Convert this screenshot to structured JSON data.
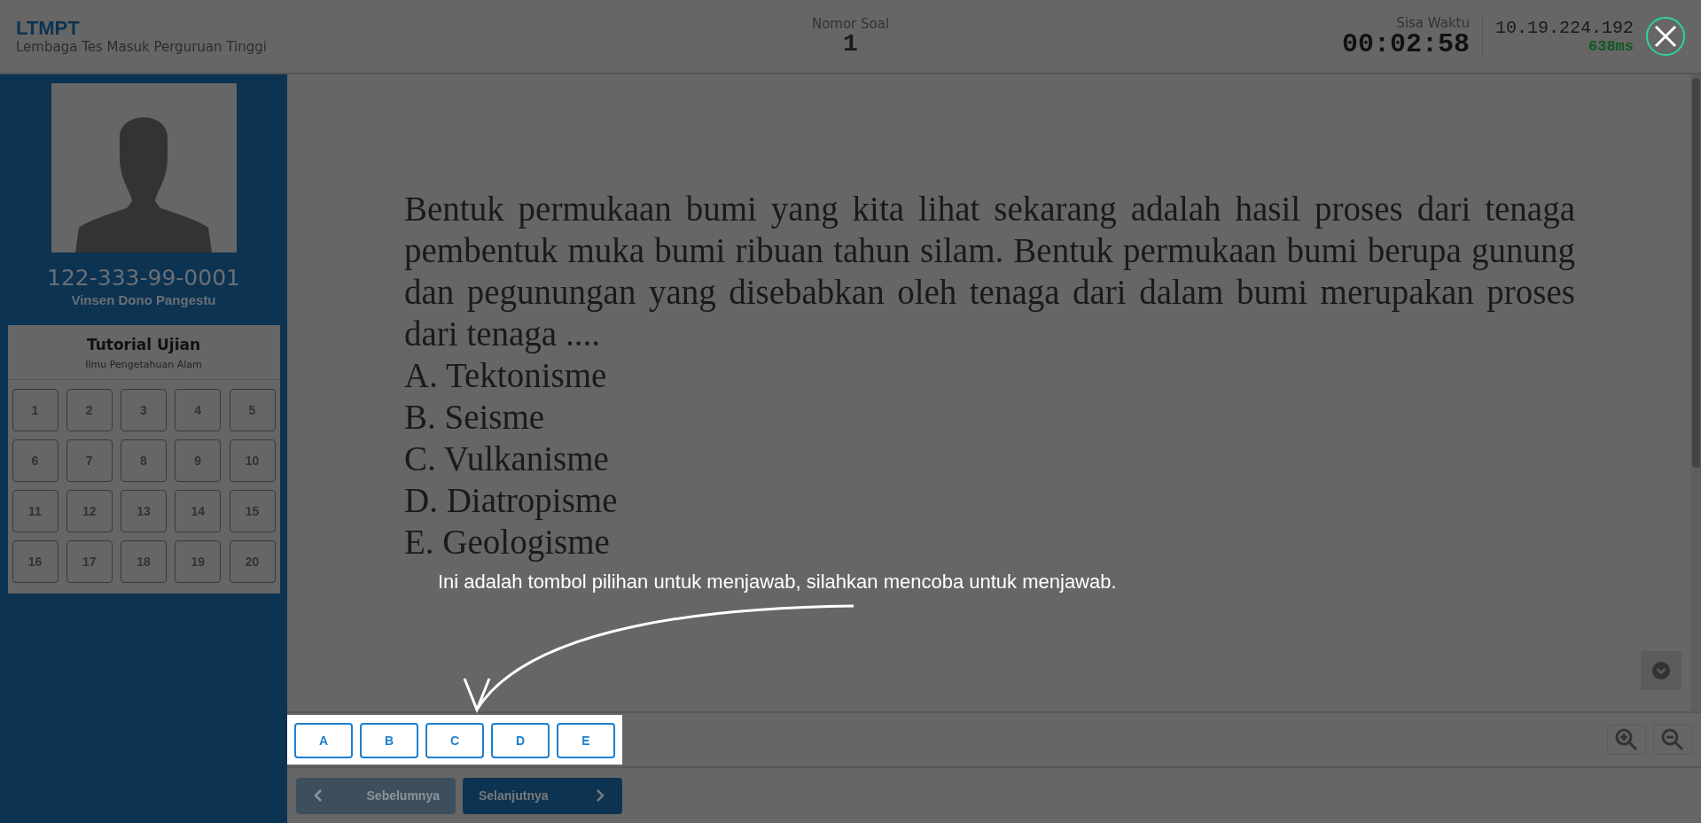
{
  "header": {
    "logo": "LTMPT",
    "subtitle": "Lembaga Tes Masuk Perguruan Tinggi",
    "question_label": "Nomor Soal",
    "question_number": "1",
    "timer_label": "Sisa Waktu",
    "timer": "00:02:58",
    "ip": "10.19.224.192",
    "latency": "638ms"
  },
  "participant": {
    "id": "122-333-99-0001",
    "name": "Vinsen Dono Pangestu"
  },
  "exam": {
    "title": "Tutorial Ujian",
    "subject": "Ilmu Pengetahuan Alam",
    "questions": [
      "1",
      "2",
      "3",
      "4",
      "5",
      "6",
      "7",
      "8",
      "9",
      "10",
      "11",
      "12",
      "13",
      "14",
      "15",
      "16",
      "17",
      "18",
      "19",
      "20"
    ]
  },
  "question": {
    "text": "Bentuk permukaan bumi yang kita lihat sekarang adalah hasil proses dari tenaga pembentuk muka bumi ribuan tahun silam. Bentuk permukaan bumi berupa gunung dan pegunungan yang disebabkan oleh tenaga dari dalam bumi merupakan proses dari tenaga ....",
    "options": [
      "A. Tektonisme",
      "B. Seisme",
      "C. Vulkanisme",
      "D. Diatropisme",
      "E. Geologisme"
    ]
  },
  "answers": [
    "A",
    "B",
    "C",
    "D",
    "E"
  ],
  "navigation": [
    {
      "kind": "previous",
      "label": "Sebelumnya",
      "disabled": true
    },
    {
      "kind": "next",
      "label": "Selanjutnya",
      "disabled": false
    }
  ],
  "tutorial": {
    "hint": "Ini adalah tombol pilihan untuk menjawab, silahkan mencoba untuk menjawab."
  }
}
